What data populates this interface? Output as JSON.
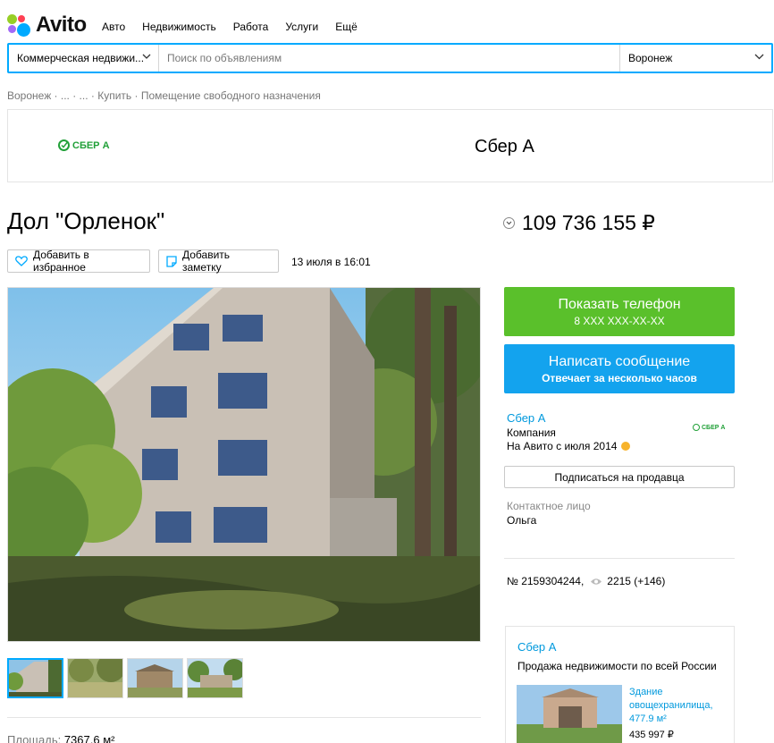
{
  "brand": {
    "name": "Avito",
    "dot_colors": [
      "#ff4053",
      "#97cf26",
      "#a169f7",
      "#00aaff"
    ]
  },
  "nav": [
    "Авто",
    "Недвижимость",
    "Работа",
    "Услуги",
    "Ещё"
  ],
  "search": {
    "category": "Коммерческая недвижи...",
    "placeholder": "Поиск по объявлениям",
    "city": "Воронеж"
  },
  "breadcrumb": "Воронеж · ... · ... · Купить · Помещение свободного назначения",
  "banner": {
    "logo_text": "СБЕР А",
    "title": "Сбер А"
  },
  "listing": {
    "title": "Дол \"Орленок\"",
    "price": "109 736 155 ₽",
    "favorite_label": "Добавить в избранное",
    "note_label": "Добавить заметку",
    "date": "13 июля в 16:01",
    "area_label": "Площадь:",
    "area_value": "7367,6 м²"
  },
  "actions": {
    "phone_label": "Показать телефон",
    "phone_masked": "8 XXX XXX-XX-XX",
    "message_label": "Написать сообщение",
    "message_sub": "Отвечает за несколько часов",
    "subscribe_label": "Подписаться на продавца"
  },
  "seller": {
    "name": "Сбер А",
    "type": "Компания",
    "since": "На Авито с июля 2014",
    "logo_text": "СБЕР А",
    "contact_label": "Контактное лицо",
    "contact_name": "Ольга"
  },
  "meta": {
    "number": "№ 2159304244,",
    "views": "2215 (+146)"
  },
  "seller_card": {
    "name": "Сбер А",
    "description": "Продажа недвижимости по всей России",
    "item_title": "Здание овощехранилища, 477.9 м²",
    "item_price": "435 997 ₽"
  },
  "colors": {
    "accent_blue": "#00aaff",
    "phone_green": "#5ac02b",
    "message_blue": "#13a3ee",
    "link_blue": "#0099dd",
    "sber_green": "#21a038"
  },
  "icons": {
    "favorite": "heart-icon",
    "note": "note-icon",
    "views": "eye-icon",
    "price_toggle": "chevron-down-icon"
  }
}
